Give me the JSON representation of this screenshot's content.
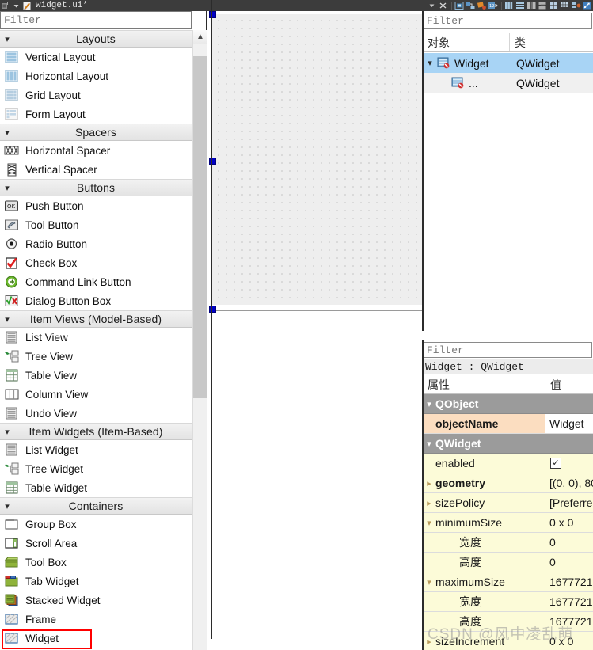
{
  "toolbar": {
    "title": "widget.ui*",
    "icons": [
      "app-logo-icon",
      "dropdown-arrow-icon",
      "edit-pencil-icon"
    ],
    "right_icons": [
      "dropdown-arrow-icon",
      "close-icon",
      "edit-widgets-icon",
      "edit-signals-icon",
      "edit-buddies-icon",
      "edit-tab-order-icon",
      "layout-horizontal-icon",
      "layout-vertical-icon",
      "layout-splitter-h-icon",
      "layout-splitter-v-icon",
      "layout-grid-icon",
      "layout-form-icon",
      "break-layout-icon",
      "adjust-size-icon"
    ]
  },
  "widget_box": {
    "filter_placeholder": "Filter",
    "categories": [
      {
        "name": "Layouts",
        "collapse_icon": "chevron-down-icon",
        "items": [
          {
            "label": "Vertical Layout",
            "icon": "vertical-layout-icon"
          },
          {
            "label": "Horizontal Layout",
            "icon": "horizontal-layout-icon"
          },
          {
            "label": "Grid Layout",
            "icon": "grid-layout-icon"
          },
          {
            "label": "Form Layout",
            "icon": "form-layout-icon"
          }
        ]
      },
      {
        "name": "Spacers",
        "collapse_icon": "chevron-down-icon",
        "items": [
          {
            "label": "Horizontal Spacer",
            "icon": "horizontal-spacer-icon"
          },
          {
            "label": "Vertical Spacer",
            "icon": "vertical-spacer-icon"
          }
        ]
      },
      {
        "name": "Buttons",
        "collapse_icon": "chevron-down-icon",
        "items": [
          {
            "label": "Push Button",
            "icon": "push-button-icon"
          },
          {
            "label": "Tool Button",
            "icon": "tool-button-icon"
          },
          {
            "label": "Radio Button",
            "icon": "radio-button-icon"
          },
          {
            "label": "Check Box",
            "icon": "check-box-icon"
          },
          {
            "label": "Command Link Button",
            "icon": "command-link-icon"
          },
          {
            "label": "Dialog Button Box",
            "icon": "dialog-button-box-icon"
          }
        ]
      },
      {
        "name": "Item Views (Model-Based)",
        "collapse_icon": "chevron-down-icon",
        "items": [
          {
            "label": "List View",
            "icon": "list-view-icon"
          },
          {
            "label": "Tree View",
            "icon": "tree-view-icon"
          },
          {
            "label": "Table View",
            "icon": "table-view-icon"
          },
          {
            "label": "Column View",
            "icon": "column-view-icon"
          },
          {
            "label": "Undo View",
            "icon": "undo-view-icon"
          }
        ]
      },
      {
        "name": "Item Widgets (Item-Based)",
        "collapse_icon": "chevron-down-icon",
        "items": [
          {
            "label": "List Widget",
            "icon": "list-widget-icon"
          },
          {
            "label": "Tree Widget",
            "icon": "tree-widget-icon"
          },
          {
            "label": "Table Widget",
            "icon": "table-widget-icon"
          }
        ]
      },
      {
        "name": "Containers",
        "collapse_icon": "chevron-down-icon",
        "items": [
          {
            "label": "Group Box",
            "icon": "group-box-icon"
          },
          {
            "label": "Scroll Area",
            "icon": "scroll-area-icon"
          },
          {
            "label": "Tool Box",
            "icon": "tool-box-icon"
          },
          {
            "label": "Tab Widget",
            "icon": "tab-widget-icon"
          },
          {
            "label": "Stacked Widget",
            "icon": "stacked-widget-icon"
          },
          {
            "label": "Frame",
            "icon": "frame-icon"
          },
          {
            "label": "Widget",
            "icon": "widget-icon",
            "highlighted": true
          }
        ]
      }
    ],
    "scrollbar": {
      "up_arrow_icon": "chevron-up-icon"
    }
  },
  "form_canvas": {
    "selection_handle_icon": "resize-handle",
    "annotation_color": "#ff1a1a",
    "grid_dot_color": "#a8a8a8",
    "background": "#eeeeee"
  },
  "object_inspector": {
    "filter_placeholder": "Filter",
    "columns": [
      "对象",
      "类"
    ],
    "rows": [
      {
        "name": "Widget",
        "klass": "QWidget",
        "icon": "qwidget-icon",
        "expander": "chevron-down-icon",
        "selected": true
      },
      {
        "name": "...",
        "klass": "QWidget",
        "icon": "qwidget-icon",
        "expander": "",
        "selected": false
      }
    ]
  },
  "property_editor": {
    "filter_placeholder": "Filter",
    "object_line": "Widget : QWidget",
    "columns": [
      "属性",
      "值"
    ],
    "rows": [
      {
        "kind": "group",
        "twisty": "chevron-down-icon",
        "name": "QObject",
        "value": ""
      },
      {
        "kind": "objname",
        "twisty": "",
        "name": "objectName",
        "value": "Widget",
        "bold": true
      },
      {
        "kind": "group",
        "twisty": "chevron-down-icon",
        "name": "QWidget",
        "value": ""
      },
      {
        "kind": "norm",
        "twisty": "",
        "name": "enabled",
        "value": "",
        "checkbox": true
      },
      {
        "kind": "norm",
        "twisty": "chevron-right-icon",
        "name": "geometry",
        "value": "[(0, 0), 80",
        "bold": true
      },
      {
        "kind": "norm",
        "twisty": "chevron-right-icon",
        "name": "sizePolicy",
        "value": "[Preferre"
      },
      {
        "kind": "norm",
        "twisty": "chevron-down-icon",
        "name": "minimumSize",
        "value": "0 x 0"
      },
      {
        "kind": "norm",
        "twisty": "",
        "sub": true,
        "name": "宽度",
        "value": "0"
      },
      {
        "kind": "norm",
        "twisty": "",
        "sub": true,
        "name": "高度",
        "value": "0"
      },
      {
        "kind": "norm",
        "twisty": "chevron-down-icon",
        "name": "maximumSize",
        "value": "1677721"
      },
      {
        "kind": "norm",
        "twisty": "",
        "sub": true,
        "name": "宽度",
        "value": "1677721"
      },
      {
        "kind": "norm",
        "twisty": "",
        "sub": true,
        "name": "高度",
        "value": "1677721"
      },
      {
        "kind": "norm",
        "twisty": "chevron-right-icon",
        "name": "sizeIncrement",
        "value": "0 x 0"
      }
    ]
  },
  "watermark": {
    "text": "CSDN @风中凌乱萌"
  }
}
